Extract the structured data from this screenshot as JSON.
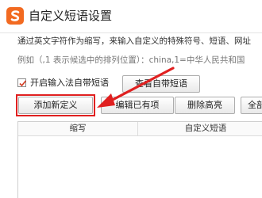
{
  "window": {
    "title": "自定义短语设置"
  },
  "description": {
    "line1": "通过英文字符作为缩写，来输入自定义的特殊符号、短语、网址",
    "line2": "例如（,1 表示候选中的排列位置）：china,1=中华人民共和国"
  },
  "options": {
    "enable_builtin_label": "开启输入法自带短语",
    "enable_builtin_checked": true
  },
  "buttons": {
    "view_builtin": "查看自带短语",
    "add_new": "添加新定义",
    "edit_existing": "编辑已有项",
    "delete_highlight": "删除高亮",
    "select_all": "全部"
  },
  "table": {
    "columns": [
      "缩写",
      "自定义短语"
    ],
    "rows": []
  },
  "colors": {
    "brand": "#f26a21",
    "annotation": "#e02020"
  },
  "icons": {
    "logo": "sogou-s-logo-icon",
    "check": "checkmark-icon"
  }
}
